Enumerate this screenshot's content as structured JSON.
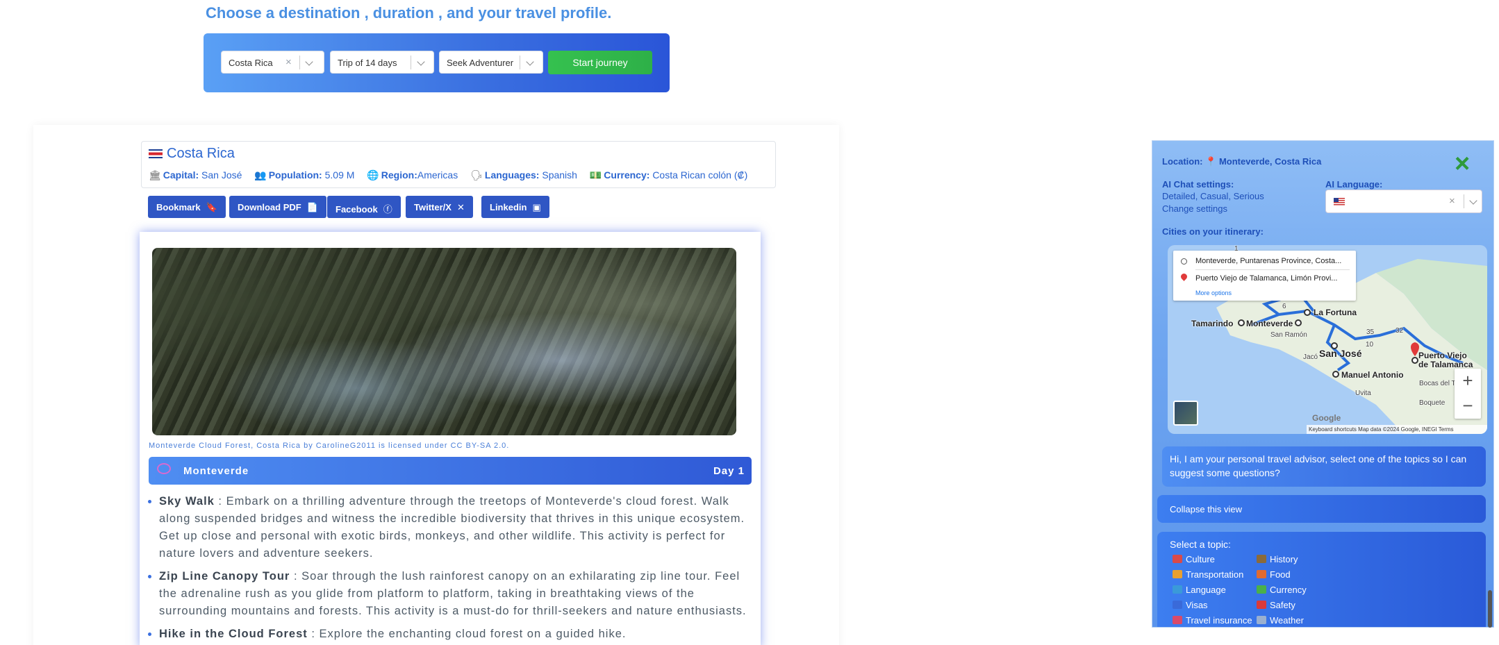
{
  "header": {
    "headline": "Choose a destination , duration , and your travel profile.",
    "destination_value": "Costa Rica",
    "duration_value": "Trip of 14 days",
    "profile_value": "Seek Adventurer",
    "start_label": "Start journey"
  },
  "country": {
    "name": "Costa Rica",
    "capital_label": "Capital:",
    "capital": "San José",
    "population_label": "Population:",
    "population": "5.09 M",
    "region_label": "Region:",
    "region": "Americas",
    "languages_label": "Languages:",
    "languages": "Spanish",
    "currency_label": "Currency:",
    "currency": "Costa Rican colón (₡)"
  },
  "share": {
    "bookmark": "Bookmark",
    "pdf": "Download PDF",
    "facebook": "Facebook",
    "twitter": "Twitter/X",
    "linkedin": "Linkedin"
  },
  "itinerary": {
    "photo_credit": "Monteverde Cloud Forest, Costa Rica by CarolineG2011 is licensed under CC BY-SA 2.0.",
    "city": "Monteverde",
    "day": "Day 1",
    "activities": [
      {
        "name": "Sky Walk",
        "text": " : Embark on a thrilling adventure through the treetops of Monteverde's cloud forest. Walk along suspended bridges and witness the incredible biodiversity that thrives in this unique ecosystem. Get up close and personal with exotic birds, monkeys, and other wildlife. This activity is perfect for nature lovers and adventure seekers."
      },
      {
        "name": "Zip Line Canopy Tour",
        "text": " : Soar through the lush rainforest canopy on an exhilarating zip line tour. Feel the adrenaline rush as you glide from platform to platform, taking in breathtaking views of the surrounding mountains and forests. This activity is a must-do for thrill-seekers and nature enthusiasts."
      },
      {
        "name": "Hike in the Cloud Forest",
        "text": " : Explore the enchanting cloud forest on a guided hike."
      }
    ]
  },
  "advisor": {
    "location_label": "Location:",
    "location": "Monteverde, Costa Rica",
    "close_icon": "×",
    "chat_settings_label": "AI Chat settings:",
    "chat_settings_values": "Detailed, Casual, Serious",
    "change_settings": "Change settings",
    "language_label": "AI Language:",
    "cities_label": "Cities on your itinerary:",
    "map": {
      "route_from": "Monteverde, Puntarenas Province, Costa...",
      "route_to": "Puerto Viejo de Talamanca, Limón Provi...",
      "more_options": "More options",
      "labels": [
        "La Fortuna",
        "Tamarindo",
        "Monteverde",
        "San Ramón",
        "San José",
        "Jacó",
        "Manuel Antonio",
        "Uvita",
        "Puerto Viejo",
        "de Talamanca",
        "Bocas del T",
        "Boquete"
      ],
      "road_numbers": [
        "1",
        "6",
        "35",
        "10",
        "32"
      ],
      "footer": "Keyboard shortcuts   Map data ©2024 Google, INEGI   Terms",
      "google": "Google"
    },
    "greeting": "Hi, I am your personal travel advisor, select one of the topics so I can suggest some questions?",
    "collapse_label": "Collapse this view",
    "topics_title": "Select a topic:",
    "topics": [
      "Culture",
      "History",
      "Transportation",
      "Food",
      "Language",
      "Currency",
      "Visas",
      "Safety",
      "Travel insurance",
      "Weather"
    ],
    "topic_colors": [
      "#d94a4a",
      "#8a6a3a",
      "#e8a030",
      "#e06a30",
      "#3a9ad9",
      "#4ab04a",
      "#3a6ad9",
      "#d93a3a",
      "#d94a6a",
      "#9ab0d0"
    ]
  }
}
